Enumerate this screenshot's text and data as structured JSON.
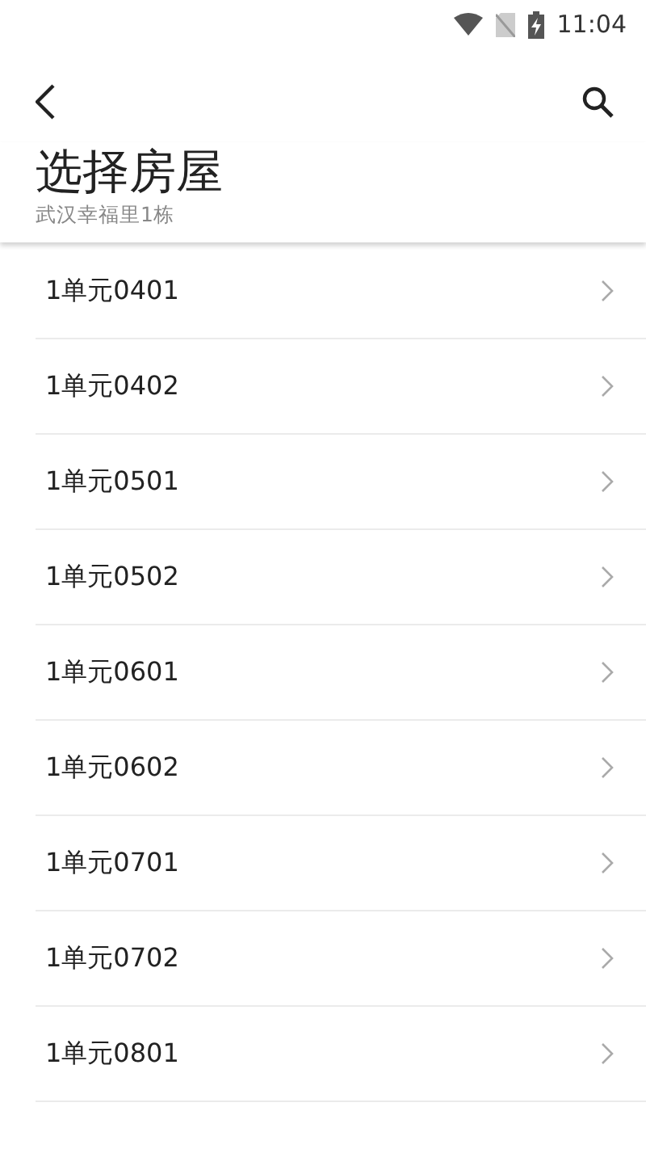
{
  "status_bar": {
    "time": "11:04"
  },
  "header": {
    "title": "选择房屋",
    "subtitle": "武汉幸福里1栋"
  },
  "rooms": [
    {
      "label": "1单元0401"
    },
    {
      "label": "1单元0402"
    },
    {
      "label": "1单元0501"
    },
    {
      "label": "1单元0502"
    },
    {
      "label": "1单元0601"
    },
    {
      "label": "1单元0602"
    },
    {
      "label": "1单元0701"
    },
    {
      "label": "1单元0702"
    },
    {
      "label": "1单元0801"
    }
  ]
}
